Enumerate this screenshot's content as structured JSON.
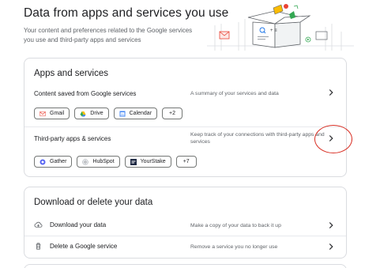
{
  "header": {
    "title": "Data from apps and services you use",
    "subtitle": "Your content and preferences related to the Google services you use and third-party apps and services"
  },
  "apps_card": {
    "title": "Apps and services",
    "content_saved": {
      "label": "Content saved from Google services",
      "description": "A summary of your services and data",
      "chips": [
        {
          "label": "Gmail",
          "icon": "gmail-icon"
        },
        {
          "label": "Drive",
          "icon": "drive-icon"
        },
        {
          "label": "Calendar",
          "icon": "calendar-icon"
        },
        {
          "label": "+2"
        }
      ]
    },
    "third_party": {
      "label": "Third-party apps & services",
      "description": "Keep track of your connections with third-party apps and services",
      "chips": [
        {
          "label": "Gather",
          "icon": "gather-icon"
        },
        {
          "label": "HubSpot",
          "icon": "hubspot-icon"
        },
        {
          "label": "YourStake",
          "icon": "yourstake-icon"
        },
        {
          "label": "+7"
        }
      ]
    }
  },
  "download_card": {
    "title": "Download or delete your data",
    "rows": [
      {
        "label": "Download your data",
        "description": "Make a copy of your data to back it up",
        "icon": "cloud-download-icon"
      },
      {
        "label": "Delete a Google service",
        "description": "Remove a service you no longer use",
        "icon": "trash-icon"
      }
    ]
  },
  "colors": {
    "highlight": "#d93025",
    "text_primary": "#202124",
    "text_secondary": "#5f6368",
    "border": "#dadce0"
  }
}
